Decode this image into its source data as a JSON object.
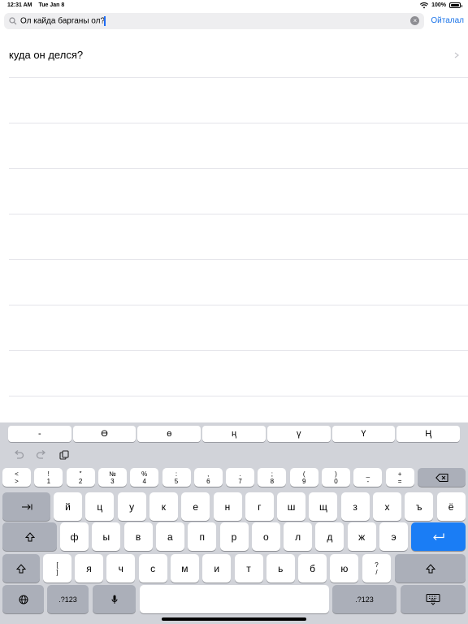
{
  "status": {
    "time": "12:31 AM",
    "date": "Tue Jan 8",
    "battery": "100%"
  },
  "search": {
    "query": "Ол кайда барганы ол?",
    "cancel_label": "Ойталал"
  },
  "results": [
    {
      "text": "куда он делся?"
    }
  ],
  "empty_rows": 7,
  "suggestions": [
    "-",
    "Ө",
    "ө",
    "ң",
    "ү",
    "Ү",
    "Ң"
  ],
  "keyboard": {
    "number_row": [
      {
        "top": "<",
        "bot": ">"
      },
      {
        "top": "!",
        "bot": "1"
      },
      {
        "top": "″",
        "bot": "2"
      },
      {
        "top": "№",
        "bot": "3"
      },
      {
        "top": "%",
        "bot": "4"
      },
      {
        "top": ":",
        "bot": "5"
      },
      {
        "top": ",",
        "bot": "6"
      },
      {
        "top": ".",
        "bot": "7"
      },
      {
        "top": ";",
        "bot": "8"
      },
      {
        "top": "(",
        "bot": "9"
      },
      {
        "top": ")",
        "bot": "0"
      },
      {
        "top": "_",
        "bot": "-"
      },
      {
        "top": "+",
        "bot": "="
      }
    ],
    "row1": [
      "й",
      "ц",
      "у",
      "к",
      "е",
      "н",
      "г",
      "ш",
      "щ",
      "з",
      "х",
      "ъ",
      "ё"
    ],
    "row2": [
      "ф",
      "ы",
      "в",
      "а",
      "п",
      "р",
      "о",
      "л",
      "д",
      "ж",
      "э"
    ],
    "row3_bracket": {
      "top": "[",
      "bot": "]"
    },
    "row3": [
      "я",
      "ч",
      "с",
      "м",
      "и",
      "т",
      "ь",
      "б",
      "ю"
    ],
    "row3_question": {
      "top": "?",
      "bot": "/"
    },
    "numbers_label": ".?123"
  }
}
